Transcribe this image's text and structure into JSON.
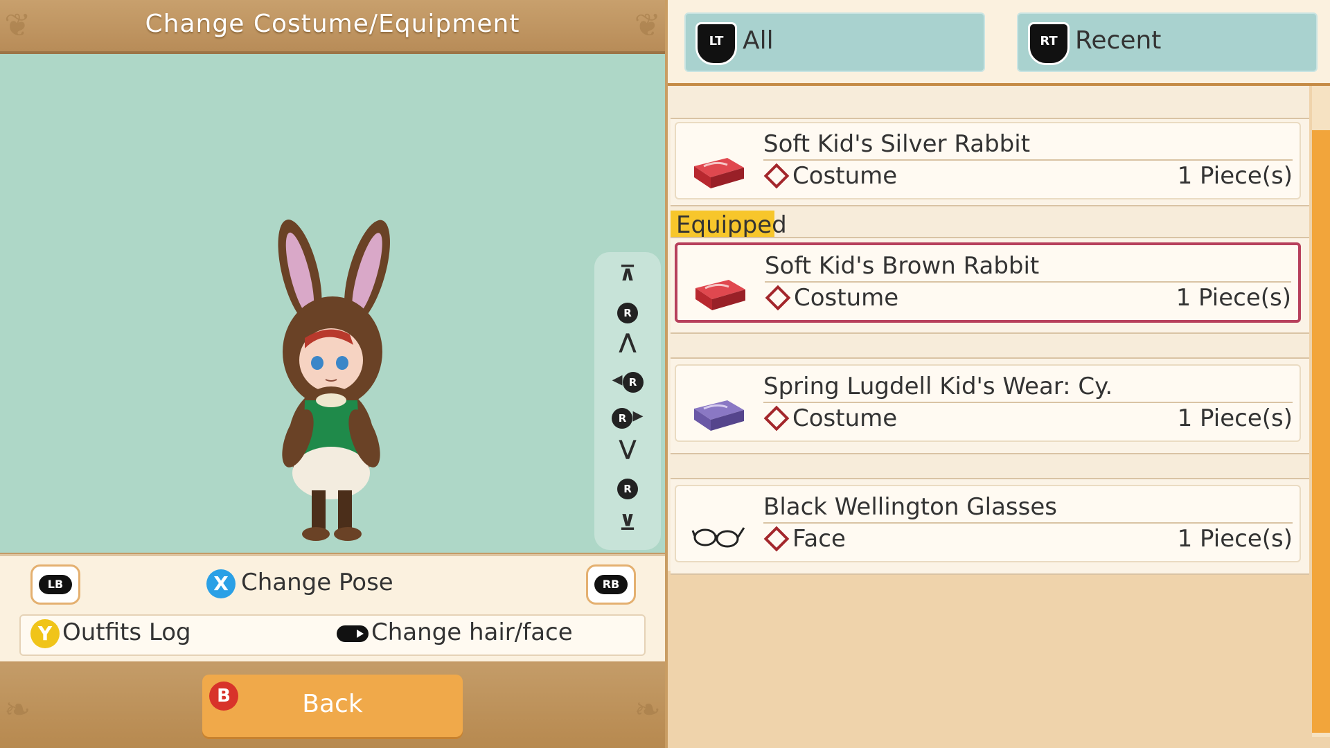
{
  "screen": {
    "title": "Change Costume/Equipment"
  },
  "left_controls": {
    "lb_label": "LB",
    "rb_label": "RB",
    "x_button": "X",
    "change_pose_label": "Change Pose",
    "y_button": "Y",
    "outfits_log_label": "Outfits Log",
    "change_hair_face_label": "Change hair/face",
    "b_button": "B",
    "back_label": "Back"
  },
  "camera_controls": {
    "r_label": "R"
  },
  "tabs": [
    {
      "trigger": "LT",
      "label": "All"
    },
    {
      "trigger": "RT",
      "label": "Recent"
    }
  ],
  "equipped_label": "Equipped",
  "items": [
    {
      "name": "Soft Kid's Silver Rabbit",
      "category": "Costume",
      "quantity": "1 Piece(s)",
      "icon": "red-suitcase-icon",
      "equipped": false
    },
    {
      "name": "Soft Kid's Brown Rabbit",
      "category": "Costume",
      "quantity": "1 Piece(s)",
      "icon": "red-suitcase-icon",
      "equipped": true
    },
    {
      "name": "Spring Lugdell Kid's Wear: Cy.",
      "category": "Costume",
      "quantity": "1 Piece(s)",
      "icon": "purple-suitcase-icon",
      "equipped": false
    },
    {
      "name": "Black Wellington Glasses",
      "category": "Face",
      "quantity": "1 Piece(s)",
      "icon": "glasses-icon",
      "equipped": false
    }
  ],
  "colors": {
    "preview_bg": "#aed7c7",
    "accent_orange": "#f0a94a",
    "equipped_border": "#b7405c",
    "equipped_tag": "#f7c62b",
    "tab_bg": "#a9d2cf"
  }
}
